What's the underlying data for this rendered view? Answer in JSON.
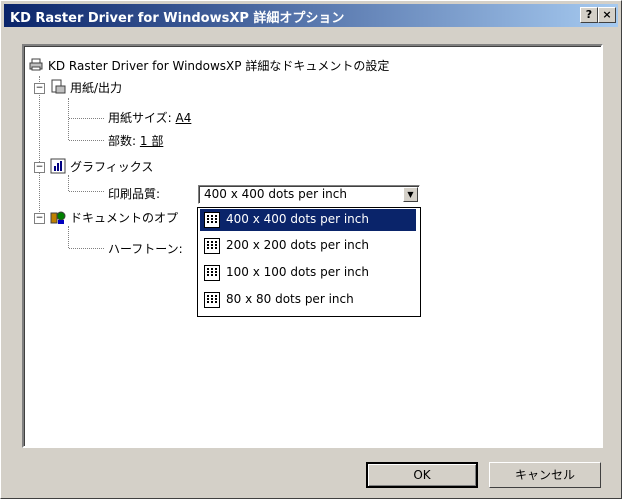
{
  "window": {
    "title": "KD Raster Driver for WindowsXP 詳細オプション",
    "help_label": "?",
    "close_label": "×"
  },
  "tree": {
    "root_label": "KD Raster Driver for WindowsXP 詳細なドキュメントの設定",
    "paper": {
      "label": "用紙/出力",
      "size_label": "用紙サイズ:",
      "size_value": "A4",
      "copies_label": "部数:",
      "copies_value": "1 部"
    },
    "graphics": {
      "label": "グラフィックス",
      "quality_label": "印刷品質:"
    },
    "doc_options": {
      "label": "ドキュメントのオプ",
      "halftone_label": "ハーフトーン:"
    }
  },
  "combo": {
    "value": "400 x 400 dots per inch",
    "options": [
      "400 x 400 dots per inch",
      "200 x 200 dots per inch",
      "100 x 100 dots per inch",
      "80 x 80 dots per inch"
    ],
    "selected_index": 0
  },
  "buttons": {
    "ok_label": "OK",
    "cancel_label": "キャンセル"
  },
  "colors": {
    "title_start": "#0a246a",
    "title_end": "#a6caf0",
    "face": "#d4d0c8",
    "selection": "#0a246a"
  }
}
